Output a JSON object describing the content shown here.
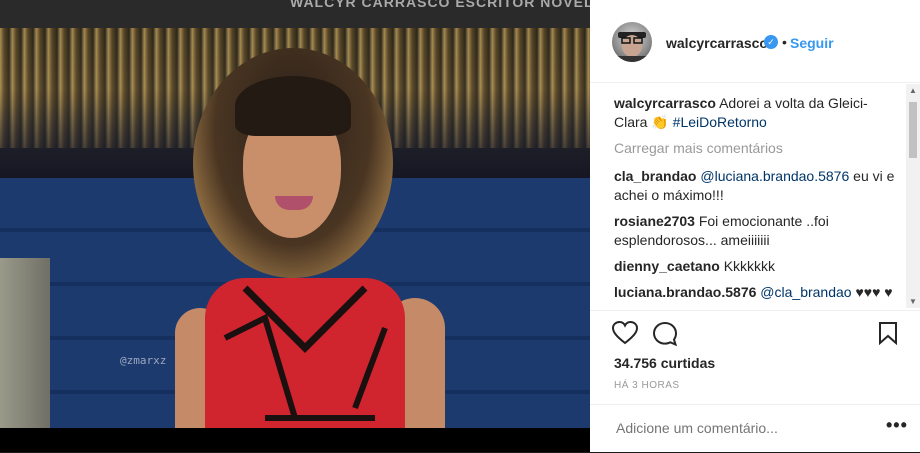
{
  "top_banner": {
    "text": "WALCYR CARRASCO ESCRITOR NOVELISTA DRAMATURGO ..."
  },
  "photo": {
    "watermark": "@zmarxz"
  },
  "post": {
    "username": "walcyrcarrasco",
    "follow_label": "Seguir",
    "dot": "•",
    "caption": {
      "user": "walcyrcarrasco",
      "text": "Adorei a volta da Gleici-Clara 👏",
      "hashtag": "#LeiDoRetorno"
    },
    "load_more_label": "Carregar mais comentários",
    "comments": [
      {
        "user": "cla_brandao",
        "mention": "@luciana.brandao.5876",
        "text": "eu vi e achei o máximo!!!"
      },
      {
        "user": "rosiane2703",
        "text": "Foi emocionante ..foi esplendorosos... ameiiiiiii"
      },
      {
        "user": "dienny_caetano",
        "text": "Kkkkkkk"
      },
      {
        "user": "luciana.brandao.5876",
        "mention": "@cla_brandao",
        "text": "♥♥♥ ♥"
      }
    ],
    "likes": "34.756 curtidas",
    "time": "HÁ 3 HORAS",
    "comment_placeholder": "Adicione um comentário...",
    "more_label": "•••"
  },
  "colors": {
    "accent": "#3897f0",
    "text": "#262626",
    "muted": "#999999"
  }
}
